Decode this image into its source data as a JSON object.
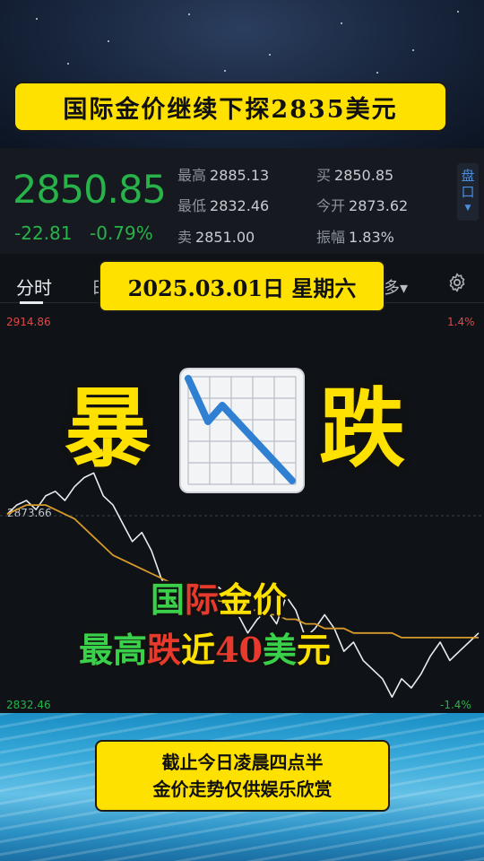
{
  "title_banner": "国际金价继续下探2835美元",
  "quote": {
    "price": "2850.85",
    "change": "-22.81",
    "change_pct": "-0.79%",
    "high_label": "最高",
    "high": "2885.13",
    "low_label": "最低",
    "low": "2832.46",
    "sell_label": "卖",
    "sell": "2851.00",
    "buy_label": "买",
    "buy": "2850.85",
    "open_label": "今开",
    "open": "2873.62",
    "amp_label": "振幅",
    "amp": "1.83%",
    "pankou_label_1": "盘",
    "pankou_label_2": "口",
    "price_color": "#27b24a"
  },
  "tabs": {
    "active": "分时",
    "partial_ri": "日",
    "more": "多▾"
  },
  "date_banner": "2025.03.01日 星期六",
  "axis": {
    "top_left": "2914.86",
    "top_right": "1.4%",
    "open_level": "2873.66",
    "bottom_left": "2832.46",
    "bottom_right": "-1.4%"
  },
  "overlay": {
    "left_char": "暴",
    "right_char": "跌",
    "line1": [
      "国",
      "际",
      "金",
      "价"
    ],
    "line1_colors": [
      "#3ad14a",
      "#e83a2c",
      "#ffe100",
      "#ffe100"
    ],
    "line2": [
      "最",
      "高",
      "跌",
      "近",
      "40",
      "美",
      "元"
    ],
    "line2_colors": [
      "#3ad14a",
      "#3ad14a",
      "#e83a2c",
      "#ffe100",
      "#e83a2c",
      "#3ad14a",
      "#ffe100"
    ]
  },
  "bottom_banner": {
    "line1": "截止今日凌晨四点半",
    "line2": "金价走势仅供娱乐欣赏"
  },
  "chart_data": {
    "type": "line",
    "ylim": [
      2832.46,
      2914.86
    ],
    "y_open": 2873.66,
    "series": [
      {
        "values": [
          2874,
          2876,
          2877,
          2875,
          2878,
          2879,
          2877,
          2880,
          2882,
          2883,
          2878,
          2876,
          2872,
          2868,
          2870,
          2866,
          2860,
          2856,
          2852,
          2856,
          2858,
          2855,
          2858,
          2856,
          2852,
          2848,
          2851,
          2853,
          2850,
          2856,
          2853,
          2847,
          2849,
          2852,
          2849,
          2844,
          2846,
          2842,
          2840,
          2838,
          2834,
          2838,
          2836,
          2839,
          2843,
          2846,
          2842,
          2844,
          2846,
          2848
        ]
      },
      {
        "values": [
          2874,
          2875,
          2876,
          2876,
          2876,
          2875,
          2874,
          2873,
          2871,
          2869,
          2867,
          2865,
          2864,
          2863,
          2862,
          2861,
          2860,
          2859,
          2858,
          2857,
          2857,
          2856,
          2855,
          2855,
          2854,
          2853,
          2853,
          2852,
          2852,
          2851,
          2851,
          2850,
          2850,
          2849,
          2849,
          2849,
          2848,
          2848,
          2848,
          2848,
          2848,
          2847,
          2847,
          2847,
          2847,
          2847,
          2847,
          2847,
          2847,
          2847
        ]
      }
    ],
    "colors": [
      "#e9ecef",
      "#d89a2a"
    ]
  }
}
